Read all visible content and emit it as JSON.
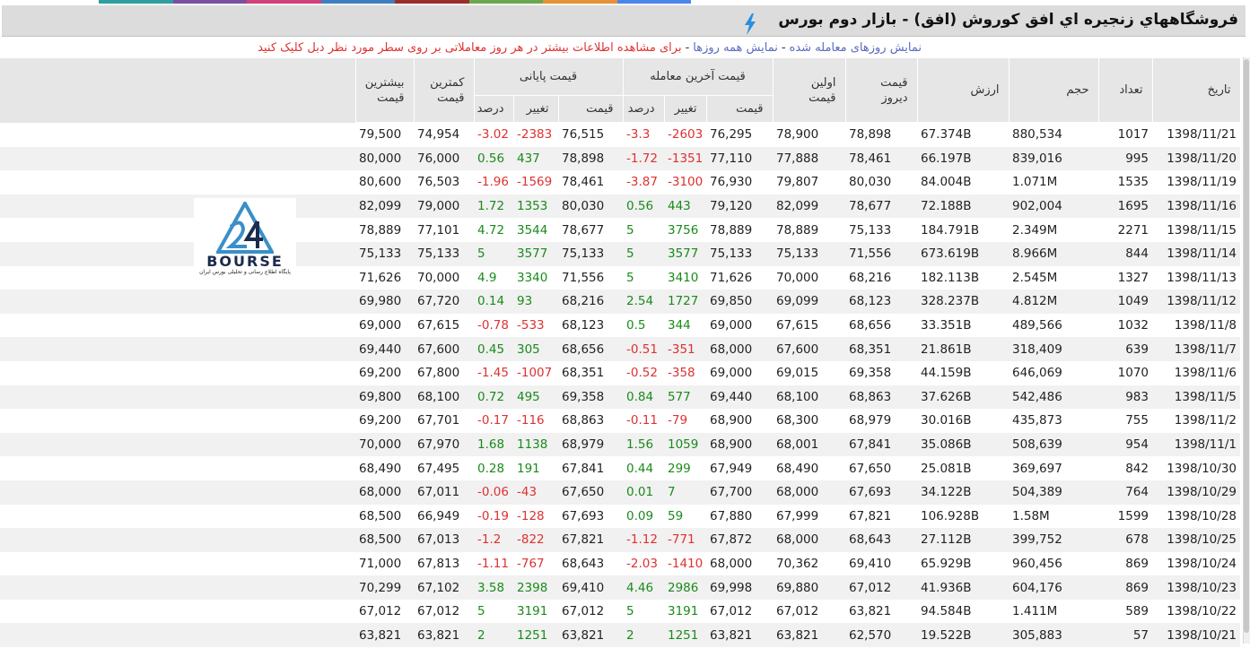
{
  "page": {
    "title": "فروشگاههاي زنجيره اي افق كوروش (افق) - بازار دوم بورس",
    "link_traded": "نمایش روزهای معامله شده",
    "link_all": "نمایش همه روزها",
    "separator": "-",
    "info_text": "برای مشاهده اطلاعات بیشتر در هر روز معاملاتی بر روی سطر مورد نظر دبل کلیک کنید",
    "icons": [
      "lightning-icon",
      "bourse-logo"
    ],
    "colors": {
      "positive": "#1a8a1a",
      "negative": "#e03030",
      "link": "#5a6bbf",
      "header_bg": "#e6e6e6"
    }
  },
  "logo": {
    "word": "BOURSE",
    "tagline": "پایگاه اطلاع رسانی و تحلیلی بورس ایران"
  },
  "table": {
    "headers": {
      "date": "تاریخ",
      "count": "تعداد",
      "volume": "حجم",
      "value": "ارزش",
      "prev_l1": "قیمت",
      "prev_l2": "دیروز",
      "first_l1": "اولین",
      "first_l2": "قیمت",
      "last_trade": "قیمت آخرین معامله",
      "final_price": "قیمت پایانی",
      "price": "قیمت",
      "change": "تغییر",
      "percent": "درصد",
      "min_l1": "کمترین",
      "min_l2": "قیمت",
      "max_l1": "بیشترین",
      "max_l2": "قیمت"
    },
    "rows": [
      {
        "date": "1398/11/21",
        "count": "1017",
        "volume": "880,534",
        "value": "67.374B",
        "prev": "78,898",
        "first": "78,900",
        "last_price": "76,295",
        "last_change": "-2603",
        "last_pct": "-3.3",
        "final_price": "76,515",
        "final_change": "-2383",
        "final_pct": "-3.02",
        "min": "74,954",
        "max": "79,500"
      },
      {
        "date": "1398/11/20",
        "count": "995",
        "volume": "839,016",
        "value": "66.197B",
        "prev": "78,461",
        "first": "77,888",
        "last_price": "77,110",
        "last_change": "-1351",
        "last_pct": "-1.72",
        "final_price": "78,898",
        "final_change": "437",
        "final_pct": "0.56",
        "min": "76,000",
        "max": "80,000"
      },
      {
        "date": "1398/11/19",
        "count": "1535",
        "volume": "1.071M",
        "value": "84.004B",
        "prev": "80,030",
        "first": "79,807",
        "last_price": "76,930",
        "last_change": "-3100",
        "last_pct": "-3.87",
        "final_price": "78,461",
        "final_change": "-1569",
        "final_pct": "-1.96",
        "min": "76,503",
        "max": "80,600"
      },
      {
        "date": "1398/11/16",
        "count": "1695",
        "volume": "902,004",
        "value": "72.188B",
        "prev": "78,677",
        "first": "82,099",
        "last_price": "79,120",
        "last_change": "443",
        "last_pct": "0.56",
        "final_price": "80,030",
        "final_change": "1353",
        "final_pct": "1.72",
        "min": "79,000",
        "max": "82,099"
      },
      {
        "date": "1398/11/15",
        "count": "2271",
        "volume": "2.349M",
        "value": "184.791B",
        "prev": "75,133",
        "first": "78,889",
        "last_price": "78,889",
        "last_change": "3756",
        "last_pct": "5",
        "final_price": "78,677",
        "final_change": "3544",
        "final_pct": "4.72",
        "min": "77,101",
        "max": "78,889"
      },
      {
        "date": "1398/11/14",
        "count": "844",
        "volume": "8.966M",
        "value": "673.619B",
        "prev": "71,556",
        "first": "75,133",
        "last_price": "75,133",
        "last_change": "3577",
        "last_pct": "5",
        "final_price": "75,133",
        "final_change": "3577",
        "final_pct": "5",
        "min": "75,133",
        "max": "75,133"
      },
      {
        "date": "1398/11/13",
        "count": "1327",
        "volume": "2.545M",
        "value": "182.113B",
        "prev": "68,216",
        "first": "70,000",
        "last_price": "71,626",
        "last_change": "3410",
        "last_pct": "5",
        "final_price": "71,556",
        "final_change": "3340",
        "final_pct": "4.9",
        "min": "70,000",
        "max": "71,626"
      },
      {
        "date": "1398/11/12",
        "count": "1049",
        "volume": "4.812M",
        "value": "328.237B",
        "prev": "68,123",
        "first": "69,099",
        "last_price": "69,850",
        "last_change": "1727",
        "last_pct": "2.54",
        "final_price": "68,216",
        "final_change": "93",
        "final_pct": "0.14",
        "min": "67,720",
        "max": "69,980"
      },
      {
        "date": "1398/11/8",
        "count": "1032",
        "volume": "489,566",
        "value": "33.351B",
        "prev": "68,656",
        "first": "67,615",
        "last_price": "69,000",
        "last_change": "344",
        "last_pct": "0.5",
        "final_price": "68,123",
        "final_change": "-533",
        "final_pct": "-0.78",
        "min": "67,615",
        "max": "69,000"
      },
      {
        "date": "1398/11/7",
        "count": "639",
        "volume": "318,409",
        "value": "21.861B",
        "prev": "68,351",
        "first": "67,600",
        "last_price": "68,000",
        "last_change": "-351",
        "last_pct": "-0.51",
        "final_price": "68,656",
        "final_change": "305",
        "final_pct": "0.45",
        "min": "67,600",
        "max": "69,440"
      },
      {
        "date": "1398/11/6",
        "count": "1070",
        "volume": "646,069",
        "value": "44.159B",
        "prev": "69,358",
        "first": "69,015",
        "last_price": "69,000",
        "last_change": "-358",
        "last_pct": "-0.52",
        "final_price": "68,351",
        "final_change": "-1007",
        "final_pct": "-1.45",
        "min": "67,800",
        "max": "69,200"
      },
      {
        "date": "1398/11/5",
        "count": "983",
        "volume": "542,486",
        "value": "37.626B",
        "prev": "68,863",
        "first": "68,100",
        "last_price": "69,440",
        "last_change": "577",
        "last_pct": "0.84",
        "final_price": "69,358",
        "final_change": "495",
        "final_pct": "0.72",
        "min": "68,100",
        "max": "69,800"
      },
      {
        "date": "1398/11/2",
        "count": "755",
        "volume": "435,873",
        "value": "30.016B",
        "prev": "68,979",
        "first": "68,300",
        "last_price": "68,900",
        "last_change": "-79",
        "last_pct": "-0.11",
        "final_price": "68,863",
        "final_change": "-116",
        "final_pct": "-0.17",
        "min": "67,701",
        "max": "69,200"
      },
      {
        "date": "1398/11/1",
        "count": "954",
        "volume": "508,639",
        "value": "35.086B",
        "prev": "67,841",
        "first": "68,001",
        "last_price": "68,900",
        "last_change": "1059",
        "last_pct": "1.56",
        "final_price": "68,979",
        "final_change": "1138",
        "final_pct": "1.68",
        "min": "67,970",
        "max": "70,000"
      },
      {
        "date": "1398/10/30",
        "count": "842",
        "volume": "369,697",
        "value": "25.081B",
        "prev": "67,650",
        "first": "68,490",
        "last_price": "67,949",
        "last_change": "299",
        "last_pct": "0.44",
        "final_price": "67,841",
        "final_change": "191",
        "final_pct": "0.28",
        "min": "67,495",
        "max": "68,490"
      },
      {
        "date": "1398/10/29",
        "count": "764",
        "volume": "504,389",
        "value": "34.122B",
        "prev": "67,693",
        "first": "68,000",
        "last_price": "67,700",
        "last_change": "7",
        "last_pct": "0.01",
        "final_price": "67,650",
        "final_change": "-43",
        "final_pct": "-0.06",
        "min": "67,011",
        "max": "68,000"
      },
      {
        "date": "1398/10/28",
        "count": "1599",
        "volume": "1.58M",
        "value": "106.928B",
        "prev": "67,821",
        "first": "67,999",
        "last_price": "67,880",
        "last_change": "59",
        "last_pct": "0.09",
        "final_price": "67,693",
        "final_change": "-128",
        "final_pct": "-0.19",
        "min": "66,949",
        "max": "68,500"
      },
      {
        "date": "1398/10/25",
        "count": "678",
        "volume": "399,752",
        "value": "27.112B",
        "prev": "68,643",
        "first": "68,000",
        "last_price": "67,872",
        "last_change": "-771",
        "last_pct": "-1.12",
        "final_price": "67,821",
        "final_change": "-822",
        "final_pct": "-1.2",
        "min": "67,013",
        "max": "68,500"
      },
      {
        "date": "1398/10/24",
        "count": "869",
        "volume": "960,456",
        "value": "65.929B",
        "prev": "69,410",
        "first": "70,362",
        "last_price": "68,000",
        "last_change": "-1410",
        "last_pct": "-2.03",
        "final_price": "68,643",
        "final_change": "-767",
        "final_pct": "-1.11",
        "min": "67,813",
        "max": "71,000"
      },
      {
        "date": "1398/10/23",
        "count": "869",
        "volume": "604,176",
        "value": "41.936B",
        "prev": "67,012",
        "first": "69,880",
        "last_price": "69,998",
        "last_change": "2986",
        "last_pct": "4.46",
        "final_price": "69,410",
        "final_change": "2398",
        "final_pct": "3.58",
        "min": "67,102",
        "max": "70,299"
      },
      {
        "date": "1398/10/22",
        "count": "589",
        "volume": "1.411M",
        "value": "94.584B",
        "prev": "63,821",
        "first": "67,012",
        "last_price": "67,012",
        "last_change": "3191",
        "last_pct": "5",
        "final_price": "67,012",
        "final_change": "3191",
        "final_pct": "5",
        "min": "67,012",
        "max": "67,012"
      },
      {
        "date": "1398/10/21",
        "count": "57",
        "volume": "305,883",
        "value": "19.522B",
        "prev": "62,570",
        "first": "63,821",
        "last_price": "63,821",
        "last_change": "1251",
        "last_pct": "2",
        "final_price": "63,821",
        "final_change": "1251",
        "final_pct": "2",
        "min": "63,821",
        "max": "63,821"
      }
    ]
  }
}
